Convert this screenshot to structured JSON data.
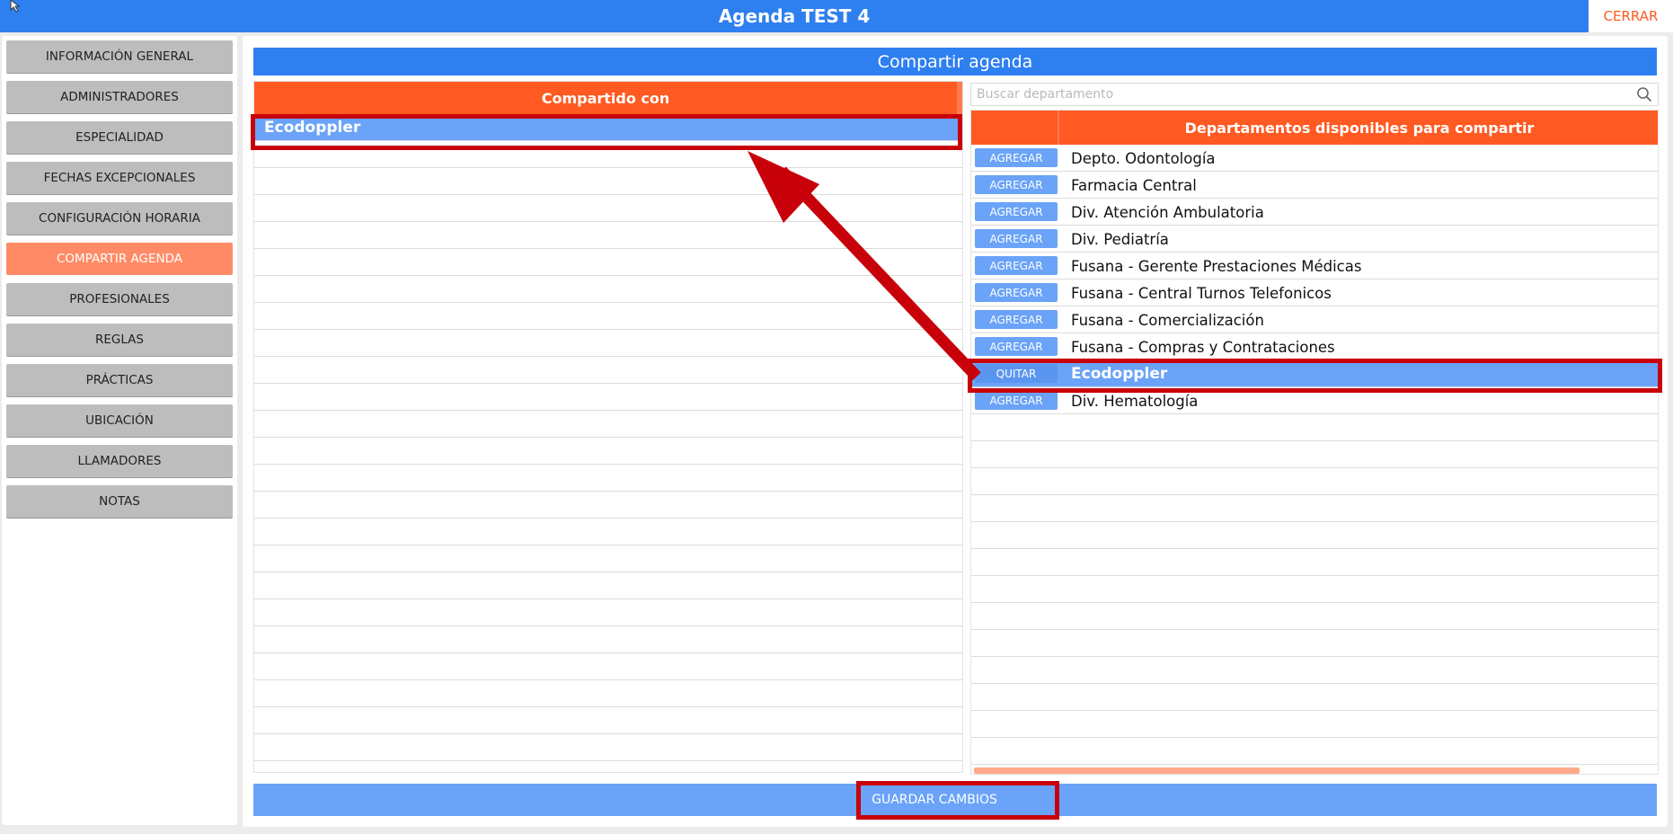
{
  "window": {
    "title": "Agenda TEST 4",
    "close_label": "CERRAR"
  },
  "sidebar": {
    "items": [
      {
        "label": "INFORMACIÓN GENERAL"
      },
      {
        "label": "ADMINISTRADORES"
      },
      {
        "label": "ESPECIALIDAD"
      },
      {
        "label": "FECHAS EXCEPCIONALES"
      },
      {
        "label": "CONFIGURACIÓN HORARIA"
      },
      {
        "label": "COMPARTIR AGENDA",
        "active": true
      },
      {
        "label": "PROFESIONALES"
      },
      {
        "label": "REGLAS"
      },
      {
        "label": "PRÁCTICAS"
      },
      {
        "label": "UBICACIÓN"
      },
      {
        "label": "LLAMADORES"
      },
      {
        "label": "NOTAS"
      }
    ]
  },
  "main": {
    "title": "Compartir agenda",
    "shared": {
      "header": "Compartido con",
      "items": [
        "Ecodoppler"
      ]
    },
    "available": {
      "search_placeholder": "Buscar departamento",
      "header": "Departamentos disponibles para compartir",
      "items": [
        {
          "action": "AGREGAR",
          "name": "Depto. Odontología"
        },
        {
          "action": "AGREGAR",
          "name": "Farmacia Central"
        },
        {
          "action": "AGREGAR",
          "name": "Div. Atención Ambulatoria"
        },
        {
          "action": "AGREGAR",
          "name": "Div. Pediatría"
        },
        {
          "action": "AGREGAR",
          "name": "Fusana - Gerente Prestaciones Médicas"
        },
        {
          "action": "AGREGAR",
          "name": "Fusana - Central Turnos Telefonicos"
        },
        {
          "action": "AGREGAR",
          "name": "Fusana - Comercialización"
        },
        {
          "action": "AGREGAR",
          "name": "Fusana - Compras y Contrataciones"
        },
        {
          "action": "QUITAR",
          "name": "Ecodoppler",
          "selected": true
        },
        {
          "action": "AGREGAR",
          "name": "Div. Hematología"
        }
      ]
    },
    "save_label": "GUARDAR CAMBIOS"
  },
  "colors": {
    "primary_blue": "#2e7ff0",
    "light_blue": "#6aa3f8",
    "orange": "#ff5a22",
    "active_item": "#ff8a66",
    "annotation_red": "#c8000a"
  }
}
